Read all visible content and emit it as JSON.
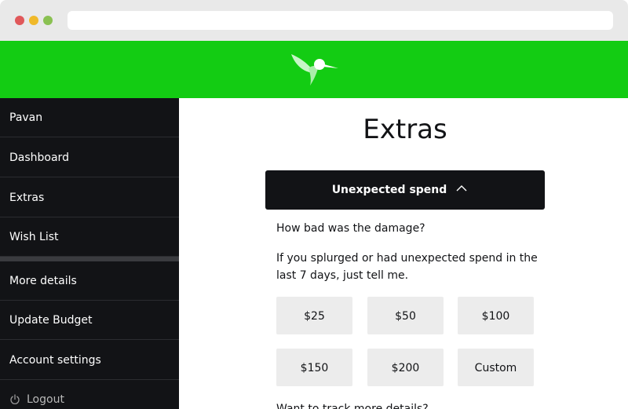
{
  "colors": {
    "brand_green": "#13cc13",
    "sidebar_bg": "#121316",
    "button_bg": "#ececec",
    "dot_red": "#e0585a",
    "dot_yellow": "#f0b92a",
    "dot_green": "#8ac152"
  },
  "header": {
    "logo_icon": "hummingbird-logo-icon"
  },
  "sidebar": {
    "items": [
      {
        "label": "Pavan"
      },
      {
        "label": "Dashboard"
      },
      {
        "label": "Extras"
      },
      {
        "label": "Wish List"
      },
      {
        "label": "More details"
      },
      {
        "label": "Update Budget"
      },
      {
        "label": "Account settings"
      }
    ],
    "logout": {
      "label": "Logout",
      "icon": "power-icon"
    }
  },
  "main": {
    "title": "Extras",
    "accordion": {
      "label": "Unexpected spend",
      "icon": "chevron-up-icon"
    },
    "question": "How bad was the damage?",
    "description": "If you splurged or had unexpected spend in the last 7 days, just tell me.",
    "amounts": [
      "$25",
      "$50",
      "$100",
      "$150",
      "$200",
      "Custom"
    ],
    "footer_text": "Want to track more details?"
  }
}
